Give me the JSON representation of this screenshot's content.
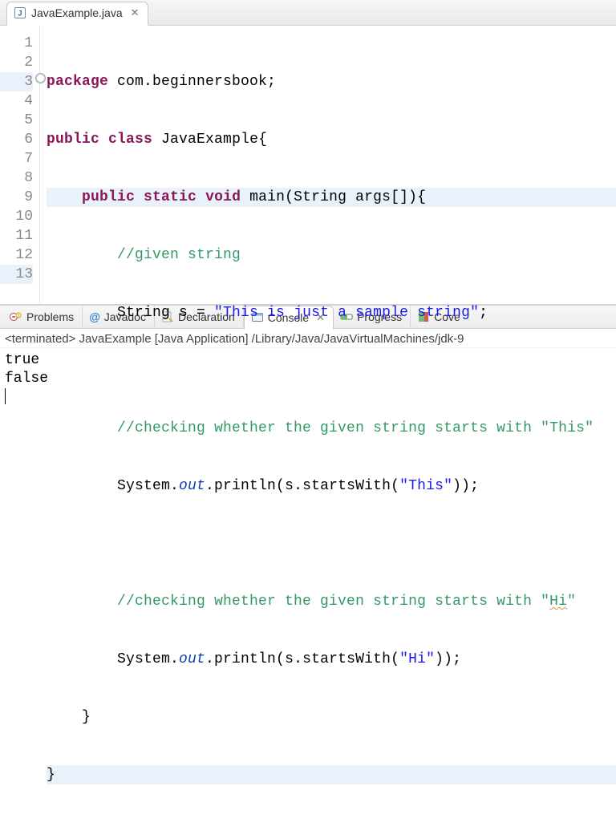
{
  "editor": {
    "tab": {
      "filename": "JavaExample.java",
      "close_glyph": "✕"
    },
    "gutter": [
      "1",
      "2",
      "3",
      "4",
      "5",
      "6",
      "7",
      "8",
      "9",
      "10",
      "11",
      "12",
      "13"
    ],
    "lines": {
      "l1": {
        "kw1": "package",
        "rest": " com.beginnersbook;"
      },
      "l2": {
        "kw1": "public",
        "kw2": "class",
        "rest": " JavaExample{"
      },
      "l3": {
        "indent": "    ",
        "kw1": "public",
        "kw2": "static",
        "kw3": "void",
        "rest": " main(String args[]){"
      },
      "l4": {
        "indent": "        ",
        "cm": "//given string"
      },
      "l5": {
        "indent": "        ",
        "pre": "String s = ",
        "str": "\"This is just a sample string\"",
        "post": ";"
      },
      "l6": {
        "blank": ""
      },
      "l7": {
        "indent": "        ",
        "cm": "//checking whether the given string starts with \"This\""
      },
      "l8": {
        "indent": "        ",
        "sys": "System.",
        "out": "out",
        "post1": ".println(s.startsWith(",
        "str": "\"This\"",
        "post2": "));"
      },
      "l9": {
        "blank": ""
      },
      "l10": {
        "indent": "        ",
        "cm_a": "//checking whether the given string starts with \"",
        "cm_hi": "Hi",
        "cm_b": "\""
      },
      "l11": {
        "indent": "        ",
        "sys": "System.",
        "out": "out",
        "post1": ".println(s.startsWith(",
        "str": "\"Hi\"",
        "post2": "));"
      },
      "l12": {
        "indent": "    ",
        "txt": "}"
      },
      "l13": {
        "txt": "}"
      }
    }
  },
  "views": {
    "problems": "Problems",
    "javadoc": "Javadoc",
    "declaration": "Declaration",
    "console": "Console",
    "progress": "Progress",
    "coverage": "Cove",
    "close_glyph": "✕",
    "at_glyph": "@"
  },
  "console": {
    "meta": "<terminated> JavaExample [Java Application] /Library/Java/JavaVirtualMachines/jdk-9",
    "out1": "true",
    "out2": "false"
  }
}
